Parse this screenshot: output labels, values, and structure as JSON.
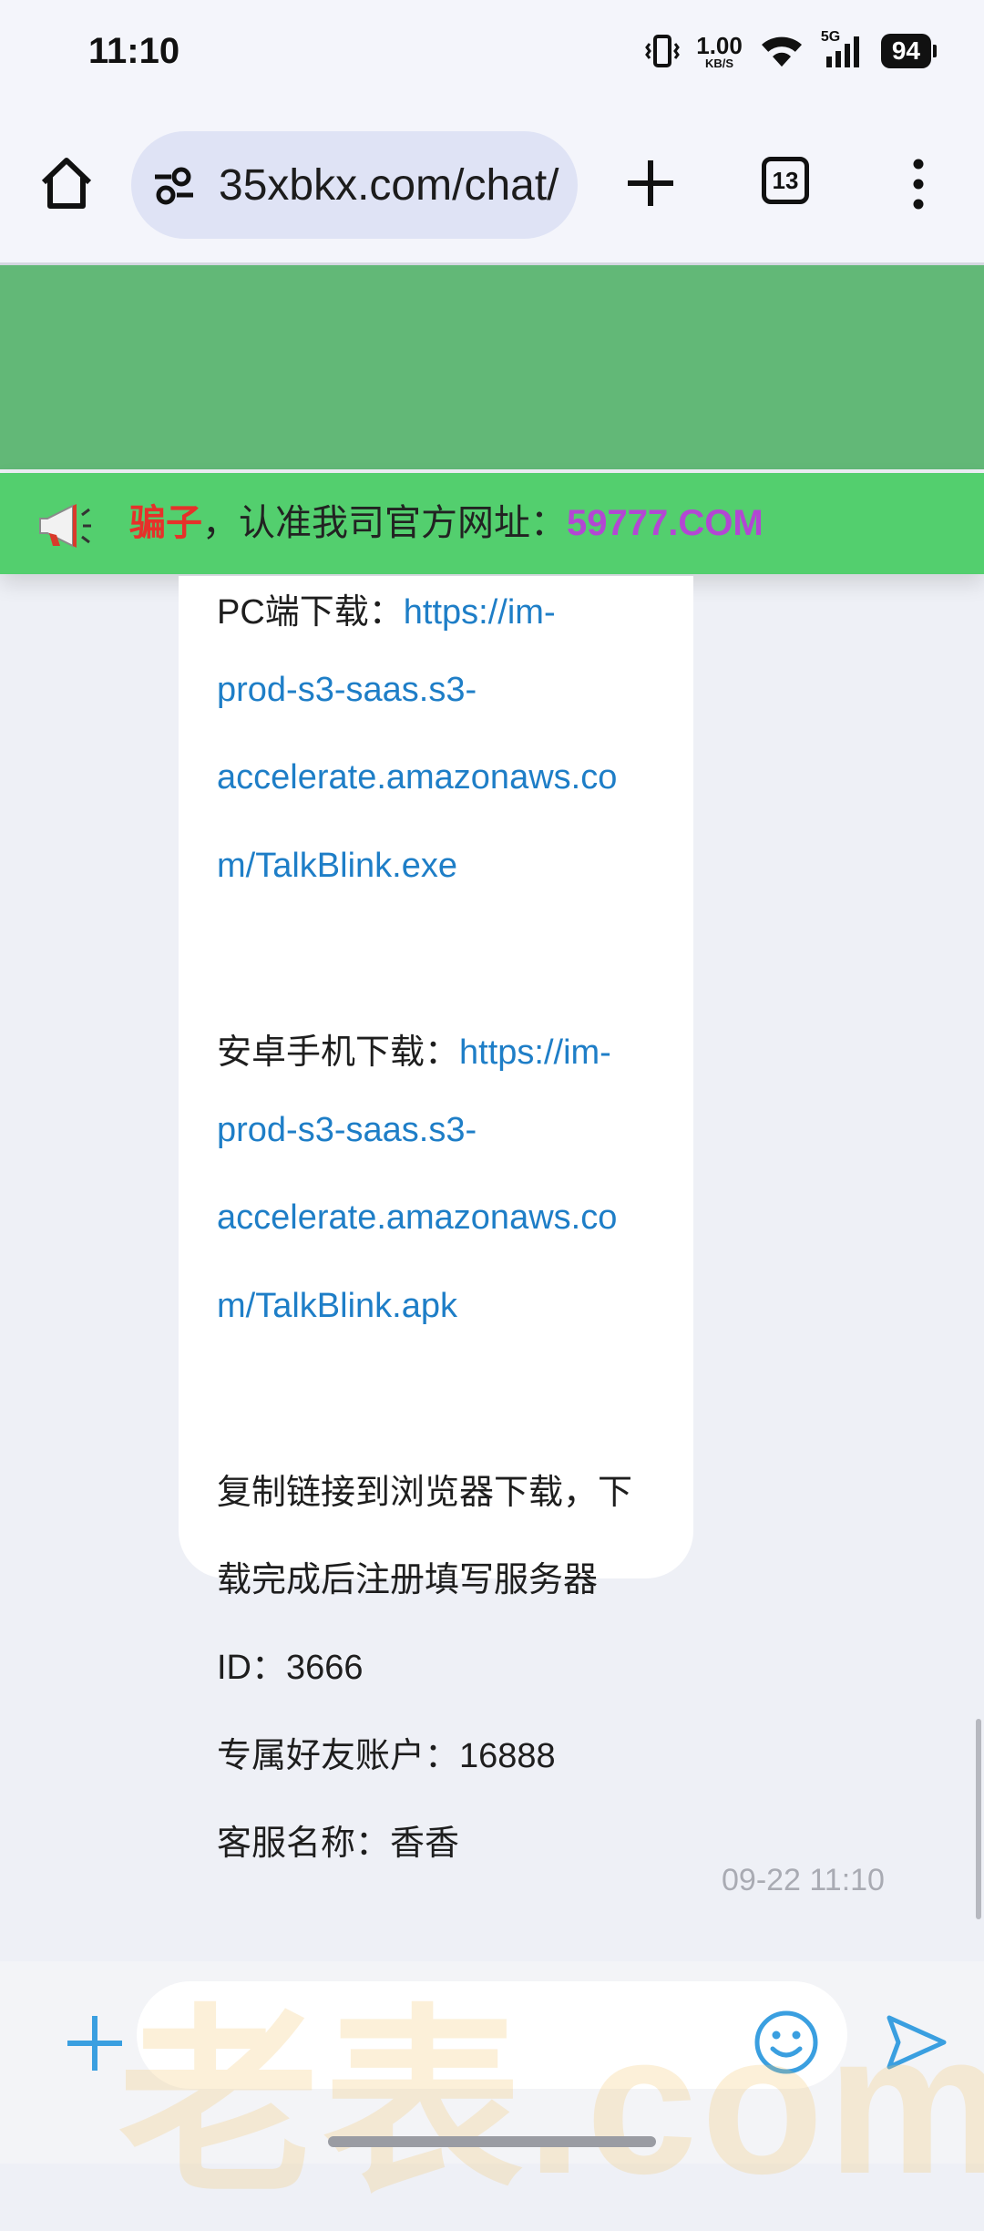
{
  "status_bar": {
    "time": "11:10",
    "net_speed_value": "1.00",
    "net_speed_unit": "KB/S",
    "network": "5G",
    "battery": "94",
    "icons": [
      "vibrate-icon",
      "wifi-icon",
      "signal-icon",
      "battery-icon"
    ]
  },
  "browser": {
    "url": "35xbkx.com/chat/",
    "tab_count": "13",
    "icons": [
      "home-icon",
      "tune-icon",
      "plus-icon",
      "tabs-icon",
      "more-vert-icon"
    ]
  },
  "notice": {
    "warning": "骗子",
    "message": "，认准我司官方网址：",
    "domain": "59777.COM",
    "colors": {
      "warning": "#e6312a",
      "domain": "#b347d3",
      "bar": "#53cf6e"
    }
  },
  "message": {
    "pc_label": "PC端下载：",
    "pc_link_1": "https://im-",
    "pc_link_2": "prod-s3-saas.s3-",
    "pc_link_3": "accelerate.amazonaws.co",
    "pc_link_4": "m/TalkBlink.exe",
    "android_label": "安卓手机下载：",
    "android_link_1": "https://im-",
    "android_link_2": "prod-s3-saas.s3-",
    "android_link_3": "accelerate.amazonaws.co",
    "android_link_4": "m/TalkBlink.apk",
    "instruction_1": "复制链接到浏览器下载，下",
    "instruction_2": "载完成后注册填写服务器",
    "server_id": "ID：3666",
    "friend_account": "专属好友账户：16888",
    "service_name": "客服名称：香香",
    "timestamp": "09-22 11:10"
  },
  "input_bar": {
    "watermark": "老表.com",
    "icons": [
      "plus-icon",
      "emoji-icon",
      "send-icon"
    ]
  }
}
